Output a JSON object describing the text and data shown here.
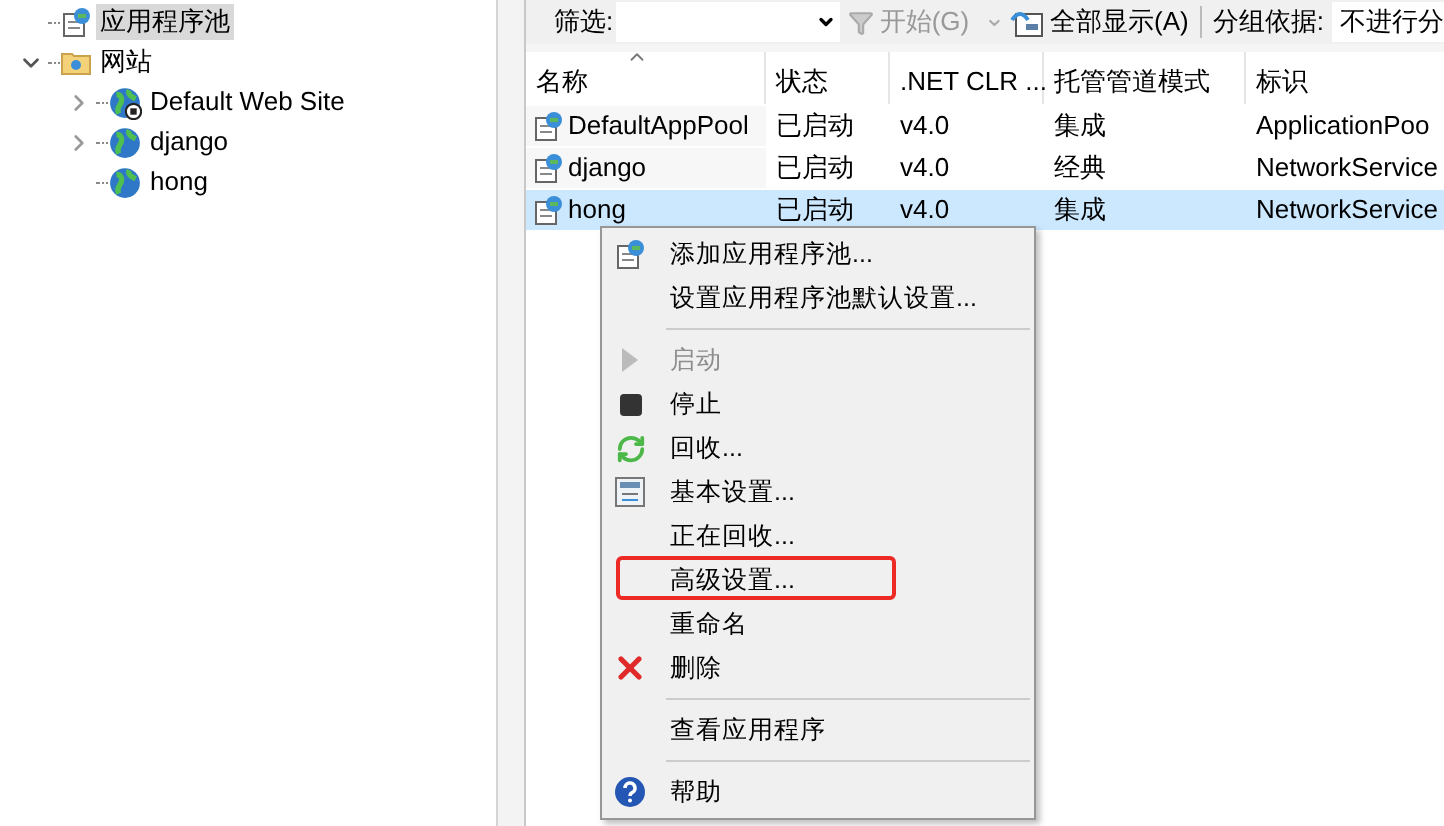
{
  "tree": [
    {
      "label": "应用程序池",
      "kind": "pool",
      "selected": true,
      "expandable": false,
      "expanded": false
    },
    {
      "label": "网站",
      "kind": "sites",
      "selected": false,
      "expandable": true,
      "expanded": true,
      "children": [
        {
          "label": "Default Web Site",
          "kind": "site-stopped",
          "selected": false,
          "expandable": true,
          "expanded": false
        },
        {
          "label": "django",
          "kind": "site",
          "selected": false,
          "expandable": true,
          "expanded": false
        },
        {
          "label": "hong",
          "kind": "site",
          "selected": false,
          "expandable": false,
          "expanded": false
        }
      ]
    }
  ],
  "toolbar": {
    "filter_label": "筛选:",
    "start_button": "开始(G)",
    "show_all_button": "全部显示(A)",
    "group_label": "分组依据:",
    "group_value": "不进行分"
  },
  "table": {
    "columns": [
      {
        "label": "名称",
        "sorted": true
      },
      {
        "label": "状态",
        "sorted": false
      },
      {
        "label": ".NET CLR ...",
        "sorted": false
      },
      {
        "label": "托管管道模式",
        "sorted": false
      },
      {
        "label": "标识",
        "sorted": false
      }
    ],
    "rows": [
      {
        "cells": [
          "DefaultAppPool",
          "已启动",
          "v4.0",
          "集成",
          "ApplicationPoo"
        ],
        "selected": false
      },
      {
        "cells": [
          "django",
          "已启动",
          "v4.0",
          "经典",
          "NetworkService"
        ],
        "selected": false
      },
      {
        "cells": [
          "hong",
          "已启动",
          "v4.0",
          "集成",
          "NetworkService"
        ],
        "selected": true
      }
    ]
  },
  "context_menu": {
    "groups": [
      [
        {
          "label": "添加应用程序池...",
          "kind": "add-pool",
          "disabled": false,
          "annotated": false
        },
        {
          "label": "设置应用程序池默认设置...",
          "kind": "plain",
          "disabled": false,
          "annotated": false
        }
      ],
      [
        {
          "label": "启动",
          "kind": "play",
          "disabled": true,
          "annotated": false
        },
        {
          "label": "停止",
          "kind": "stop",
          "disabled": false,
          "annotated": false
        },
        {
          "label": "回收...",
          "kind": "recycle",
          "disabled": false,
          "annotated": false
        },
        {
          "label": "基本设置...",
          "kind": "settings",
          "disabled": false,
          "annotated": false
        },
        {
          "label": "正在回收...",
          "kind": "plain",
          "disabled": false,
          "annotated": false
        },
        {
          "label": "高级设置...",
          "kind": "plain",
          "disabled": false,
          "annotated": true
        },
        {
          "label": "重命名",
          "kind": "plain",
          "disabled": false,
          "annotated": false
        },
        {
          "label": "删除",
          "kind": "delete",
          "disabled": false,
          "annotated": false
        }
      ],
      [
        {
          "label": "查看应用程序",
          "kind": "plain",
          "disabled": false,
          "annotated": false
        }
      ],
      [
        {
          "label": "帮助",
          "kind": "help",
          "disabled": false,
          "annotated": false
        }
      ]
    ]
  }
}
